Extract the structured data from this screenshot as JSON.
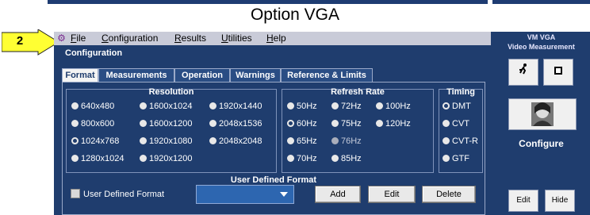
{
  "caption": "Option VGA",
  "step_number": "2",
  "menu": {
    "items": [
      "File",
      "Configuration",
      "Results",
      "Utilities",
      "Help"
    ]
  },
  "window": {
    "title": "Configuration"
  },
  "tabs": [
    "Format",
    "Measurements",
    "Operation",
    "Warnings",
    "Reference & Limits"
  ],
  "active_tab": "Format",
  "resolution": {
    "title": "Resolution",
    "options": [
      "640x480",
      "1600x1024",
      "1920x1440",
      "800x600",
      "1600x1200",
      "2048x1536",
      "1024x768",
      "1920x1080",
      "2048x2048",
      "1280x1024",
      "1920x1200"
    ],
    "selected": "1024x768"
  },
  "refresh_rate": {
    "title": "Refresh Rate",
    "options": [
      "50Hz",
      "72Hz",
      "100Hz",
      "60Hz",
      "75Hz",
      "120Hz",
      "65Hz",
      "76Hz",
      "70Hz",
      "85Hz"
    ],
    "selected": "60Hz",
    "disabled": [
      "76Hz"
    ]
  },
  "timing": {
    "title": "Timing",
    "options": [
      "DMT",
      "CVT",
      "CVT-R",
      "GTF"
    ],
    "selected": "DMT"
  },
  "user_defined": {
    "title": "User Defined Format",
    "checkbox_label": "User Defined Format",
    "dropdown_value": "",
    "buttons": {
      "add": "Add",
      "edit": "Edit",
      "delete": "Delete"
    }
  },
  "side": {
    "title_line1": "VM VGA",
    "title_line2": "Video Measurement",
    "configure_label": "Configure",
    "edit_label": "Edit",
    "hide_label": "Hide",
    "run_icon": "running-man-icon",
    "stop_icon": "stop-square-icon",
    "portrait_icon": "portrait-icon"
  },
  "colors": {
    "panel_bg": "#1f3d6e",
    "menubar_bg": "#c9cbd8",
    "arrow_fill": "#ffff33"
  }
}
